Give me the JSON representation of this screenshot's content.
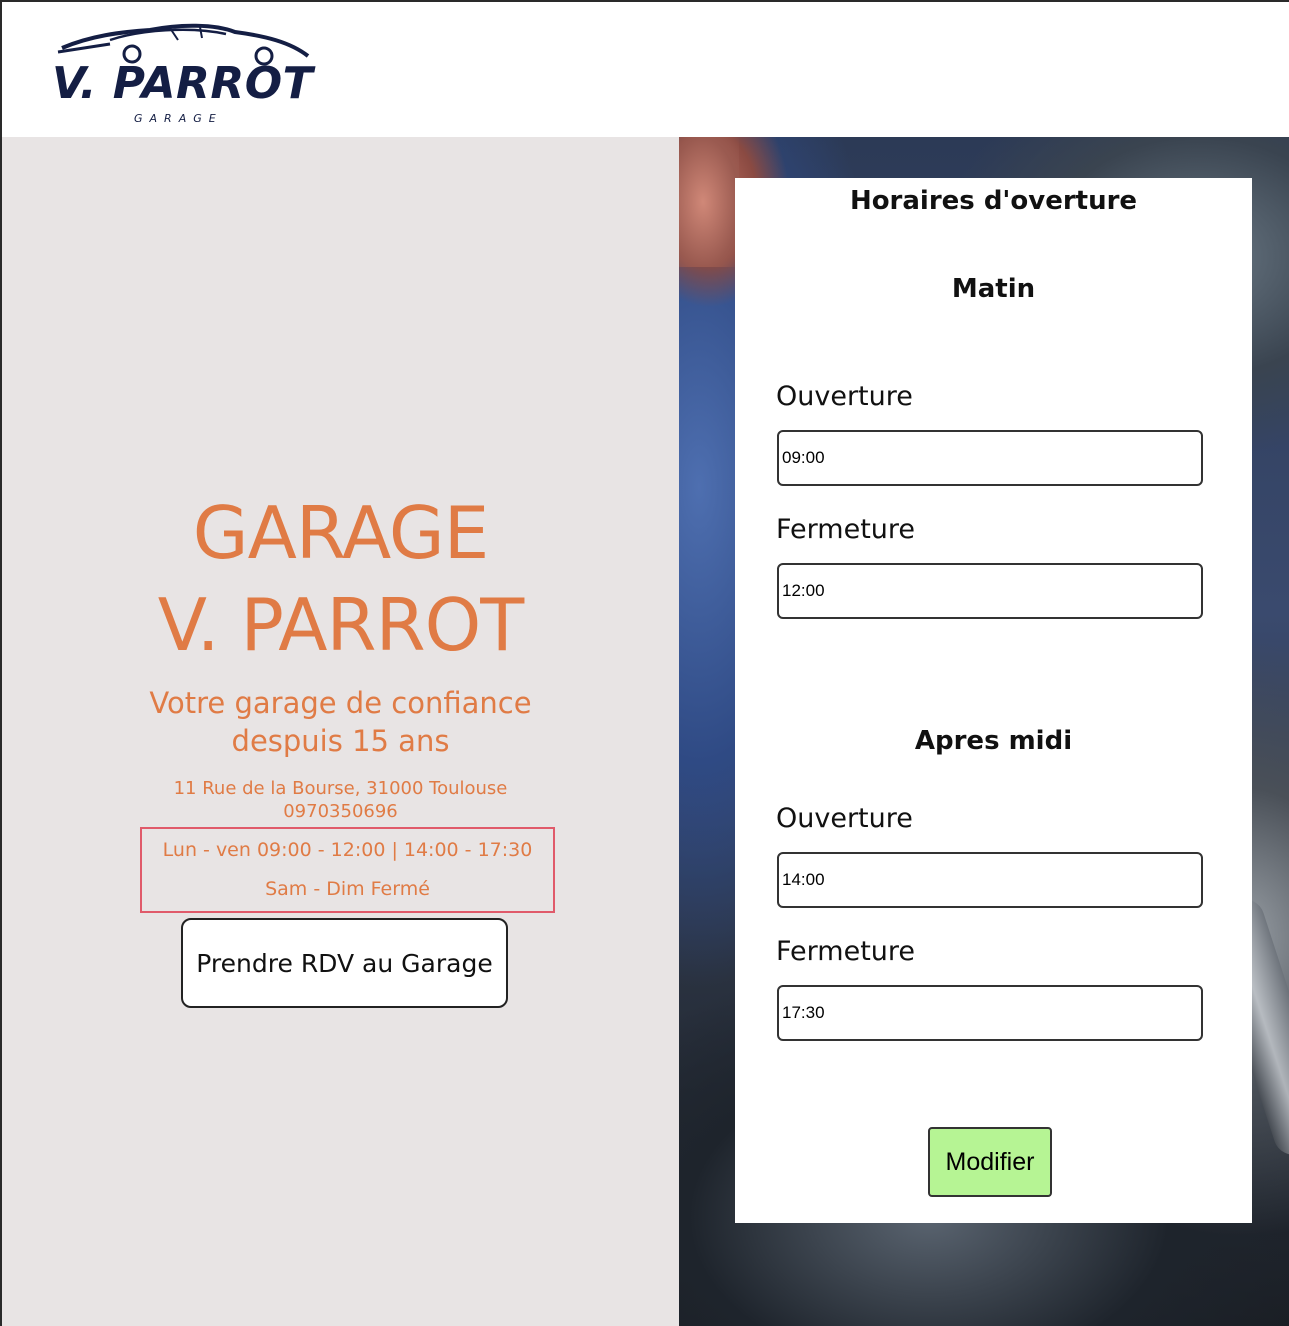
{
  "header": {
    "logo_text": "V. PARROT",
    "logo_subtitle": "GARAGE"
  },
  "hero": {
    "title_line1": "GARAGE",
    "title_line2": "V. PARROT",
    "tagline_line1": "Votre garage de confiance",
    "tagline_line2": "despuis 15 ans",
    "address": "11 Rue de la Bourse, 31000 Toulouse",
    "phone": "0970350696",
    "hours_weekdays": "Lun - ven 09:00 - 12:00  |  14:00 - 17:30",
    "hours_weekend": "Sam - Dim Fermé",
    "rdv_button": "Prendre RDV au Garage"
  },
  "hours_form": {
    "title": "Horaires d'overture",
    "morning": {
      "heading": "Matin",
      "open_label": "Ouverture",
      "open_value": "09:00",
      "close_label": "Fermeture",
      "close_value": "12:00"
    },
    "afternoon": {
      "heading": "Apres midi",
      "open_label": "Ouverture",
      "open_value": "14:00",
      "close_label": "Fermeture",
      "close_value": "17:30"
    },
    "submit_label": "Modifier"
  },
  "colors": {
    "accent_orange": "#e07b45",
    "logo_navy": "#141e44",
    "submit_green": "#b6f494",
    "highlight_red": "#e05a6a",
    "left_panel_bg": "#e8e4e4"
  }
}
